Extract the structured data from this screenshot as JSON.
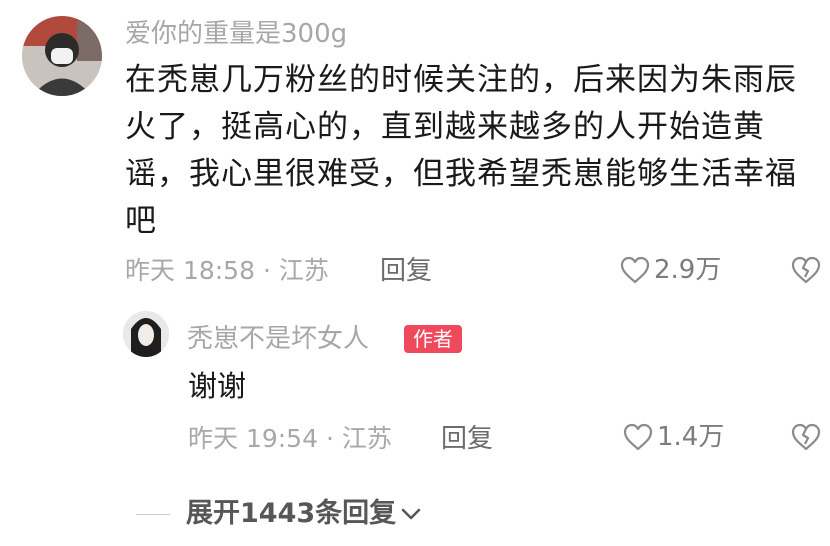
{
  "comment": {
    "username": "爱你的重量是300g",
    "text": "在秃崽几万粉丝的时候关注的，后来因为朱雨辰火了，挺高心的，直到越来越多的人开始造黄谣，我心里很难受，但我希望秃崽能够生活幸福吧",
    "meta": "昨天 18:58 · 江苏",
    "reply_label": "回复",
    "like_count": "2.9万",
    "avatar_icon": "avatar-masked-person"
  },
  "reply": {
    "username": "秃崽不是坏女人",
    "badge": "作者",
    "text": "谢谢",
    "meta": "昨天 19:54 · 江苏",
    "reply_label": "回复",
    "like_count": "1.4万",
    "avatar_icon": "avatar-dark-hair"
  },
  "expand": {
    "label": "展开1443条回复"
  },
  "colors": {
    "badge_bg": "#ee4a5c",
    "secondary_text": "#a8a8a8",
    "primary_text": "#1a1a1a"
  }
}
